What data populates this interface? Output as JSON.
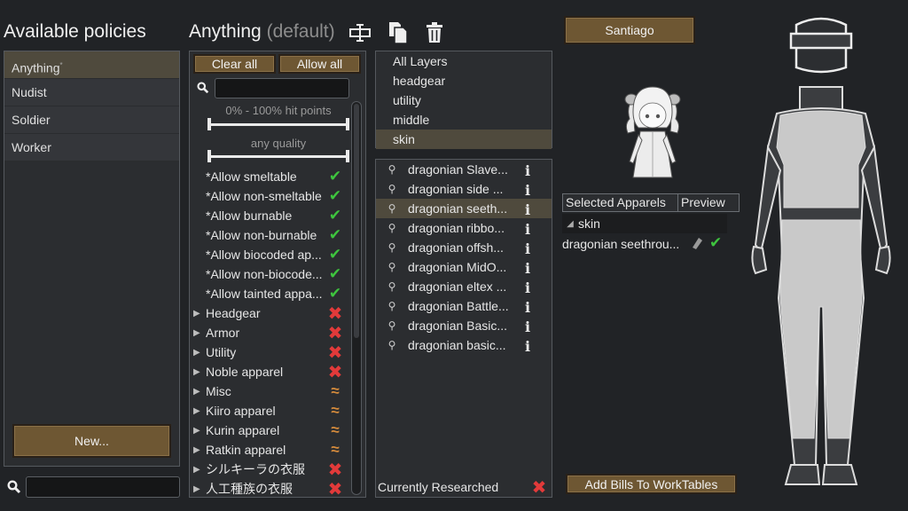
{
  "policies": {
    "title": "Available policies",
    "items": [
      {
        "label": "Anything",
        "selected": true
      },
      {
        "label": "Nudist"
      },
      {
        "label": "Soldier"
      },
      {
        "label": "Worker"
      }
    ],
    "new_button": "New..."
  },
  "editor": {
    "policy_name": "Anything",
    "default_suffix": "(default)",
    "clear_all": "Clear all",
    "allow_all": "Allow all",
    "hit_points_label": "0% - 100% hit points",
    "quality_label": "any quality",
    "filters": [
      {
        "label": "*Allow smeltable",
        "state": "ok",
        "expandable": false
      },
      {
        "label": "*Allow non-smeltable",
        "state": "ok",
        "expandable": false
      },
      {
        "label": "*Allow burnable",
        "state": "ok",
        "expandable": false
      },
      {
        "label": "*Allow non-burnable",
        "state": "ok",
        "expandable": false
      },
      {
        "label": "*Allow biocoded ap...",
        "state": "ok",
        "expandable": false
      },
      {
        "label": "*Allow non-biocode...",
        "state": "ok",
        "expandable": false
      },
      {
        "label": "*Allow tainted appa...",
        "state": "ok",
        "expandable": false
      },
      {
        "label": "Headgear",
        "state": "no",
        "expandable": true
      },
      {
        "label": "Armor",
        "state": "no",
        "expandable": true
      },
      {
        "label": "Utility",
        "state": "no",
        "expandable": true
      },
      {
        "label": "Noble apparel",
        "state": "no",
        "expandable": true
      },
      {
        "label": "Misc",
        "state": "partial",
        "expandable": true
      },
      {
        "label": "Kiiro apparel",
        "state": "partial",
        "expandable": true
      },
      {
        "label": "Kurin apparel",
        "state": "partial",
        "expandable": true
      },
      {
        "label": "Ratkin apparel",
        "state": "partial",
        "expandable": true
      },
      {
        "label": "シルキーラの衣服",
        "state": "no",
        "expandable": true
      },
      {
        "label": "人工種族の衣服",
        "state": "no",
        "expandable": true
      }
    ]
  },
  "layers": {
    "items": [
      {
        "label": "All Layers"
      },
      {
        "label": "headgear"
      },
      {
        "label": "utility"
      },
      {
        "label": "middle"
      },
      {
        "label": "skin",
        "selected": true
      }
    ]
  },
  "apparels": {
    "items": [
      {
        "label": "dragonian Slave..."
      },
      {
        "label": "dragonian side ..."
      },
      {
        "label": "dragonian seeth...",
        "selected": true
      },
      {
        "label": "dragonian ribbo..."
      },
      {
        "label": "dragonian offsh..."
      },
      {
        "label": "dragonian MidO..."
      },
      {
        "label": "dragonian eltex ..."
      },
      {
        "label": "dragonian Battle..."
      },
      {
        "label": "dragonian Basic..."
      },
      {
        "label": "dragonian basic..."
      }
    ],
    "researched_label": "Currently Researched"
  },
  "pawn": {
    "name": "Santiago"
  },
  "selected": {
    "col_selected": "Selected Apparels",
    "col_preview": "Preview",
    "group": "skin",
    "item": "dragonian seethrou...",
    "add_bills": "Add Bills To WorkTables"
  },
  "colors": {
    "accent_brown": "#6e5733",
    "check_green": "#3ec43e",
    "cross_red": "#e23a3a",
    "partial_orange": "#d58b3c",
    "selection": "#4f4a3d"
  }
}
